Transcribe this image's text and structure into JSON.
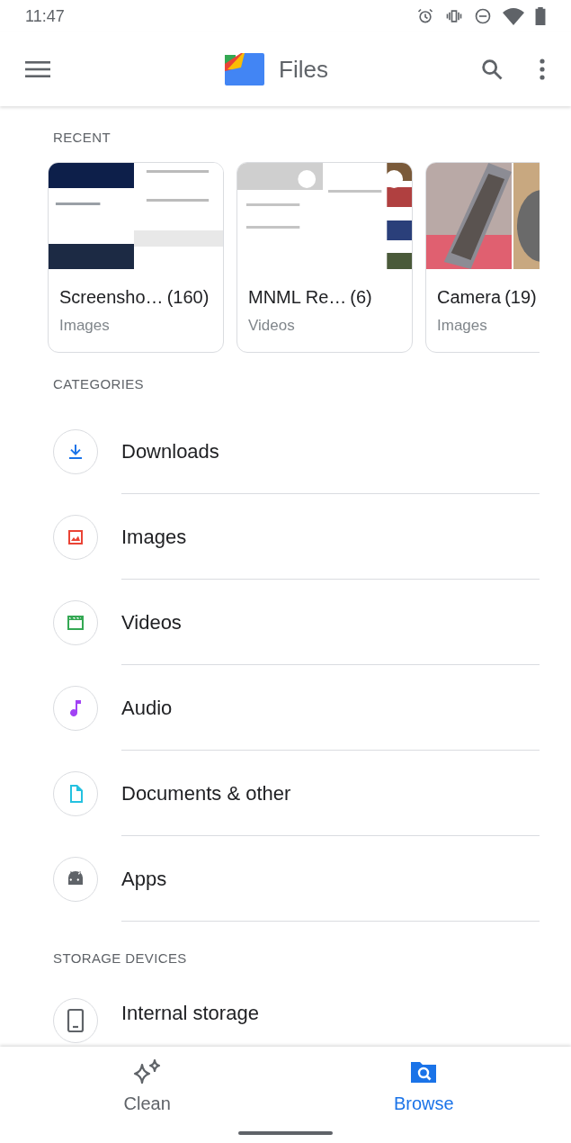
{
  "status_bar": {
    "time": "11:47"
  },
  "app_bar": {
    "title": "Files"
  },
  "recent": {
    "heading": "RECENT",
    "cards": [
      {
        "kind": "screenshots",
        "title": "Screensho…",
        "count": "(160)",
        "type": "Images"
      },
      {
        "kind": "videos",
        "title": "MNML Re…",
        "count": "(6)",
        "type": "Videos"
      },
      {
        "kind": "camera",
        "title": "Camera",
        "count": "(19)",
        "type": "Images"
      }
    ]
  },
  "categories": {
    "heading": "CATEGORIES",
    "items": [
      {
        "kind": "downloads",
        "label": "Downloads",
        "color": "#1a73e8"
      },
      {
        "kind": "images",
        "label": "Images",
        "color": "#ea4335"
      },
      {
        "kind": "videos",
        "label": "Videos",
        "color": "#34a853"
      },
      {
        "kind": "audio",
        "label": "Audio",
        "color": "#a142f4"
      },
      {
        "kind": "documents",
        "label": "Documents & other",
        "color": "#24c1e0"
      },
      {
        "kind": "apps",
        "label": "Apps",
        "color": "#5f6368"
      }
    ]
  },
  "storage": {
    "heading": "STORAGE DEVICES",
    "items": [
      {
        "label": "Internal storage"
      }
    ]
  },
  "bottom_nav": [
    {
      "kind": "clean",
      "label": "Clean",
      "selected": false
    },
    {
      "kind": "browse",
      "label": "Browse",
      "selected": true
    }
  ]
}
